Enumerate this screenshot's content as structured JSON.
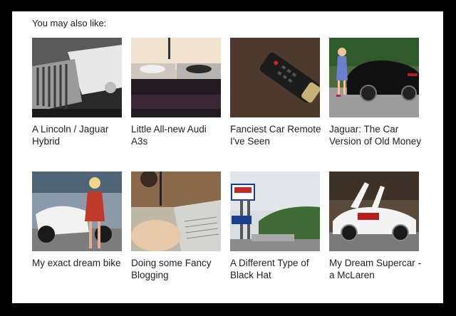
{
  "heading": "You may also like:",
  "items": [
    {
      "title": "A Lincoln / Jaguar Hybrid"
    },
    {
      "title": "Little All-new Audi A3s"
    },
    {
      "title": "Fanciest Car Remote I've Seen"
    },
    {
      "title": "Jaguar: The Car Version of Old Money"
    },
    {
      "title": "My exact dream bike"
    },
    {
      "title": "Doing some Fancy Blogging"
    },
    {
      "title": "A Different Type of Black Hat"
    },
    {
      "title": "My Dream Supercar - a McLaren"
    }
  ]
}
